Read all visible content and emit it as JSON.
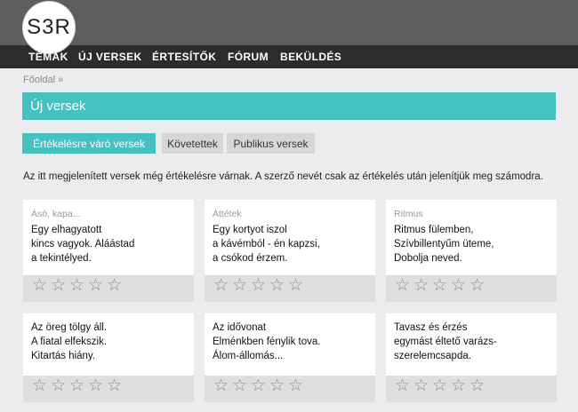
{
  "logo": {
    "text": "S3R"
  },
  "nav": [
    "TÉMÁK",
    "ÚJ VERSEK",
    "ÉRTESÍTŐK",
    "FÓRUM",
    "BEKÜLDÉS"
  ],
  "breadcrumb": "Főoldal  »",
  "page_title": "Új versek",
  "tabs": [
    {
      "label": "Értékelésre váró versek",
      "active": true
    },
    {
      "label": "Követettek",
      "active": false
    },
    {
      "label": "Publikus versek",
      "active": false
    }
  ],
  "intro": "Az itt megjelenített versek még értékelésre várnak. A szerző nevét csak az értékelés után jelenítjük meg számodra.",
  "poems": [
    {
      "author": "Ásó, kapa...",
      "lines": [
        "Egy elhagyatott",
        "kincs vagyok. Aláástad",
        "a tekintélyed."
      ],
      "rating": 0
    },
    {
      "author": "Áttétek",
      "lines": [
        "Egy kortyot iszol",
        "a kávémból - én kapzsi,",
        "a csókod érzem."
      ],
      "rating": 0
    },
    {
      "author": "Ritmus",
      "lines": [
        "Ritmus fülemben,",
        "Szívbillentyűm üteme,",
        "Dobolja neved."
      ],
      "rating": 0
    },
    {
      "author": "",
      "lines": [
        "Az öreg tölgy áll.",
        "A fiatal elfekszik.",
        "Kitartás hiány."
      ],
      "rating": 0
    },
    {
      "author": "",
      "lines": [
        "Az idővonat",
        "Elménkben fénylik tova.",
        "Álom-állomás..."
      ],
      "rating": 0
    },
    {
      "author": "",
      "lines": [
        "Tavasz és érzés",
        "egymást éltető varázs-",
        "szerelemcsapda."
      ],
      "rating": 0
    }
  ],
  "star_glyph": "☆",
  "colors": {
    "accent": "#45c1c1",
    "nav_bg": "#2c2c2c",
    "top_bg": "#5e5e5e"
  }
}
